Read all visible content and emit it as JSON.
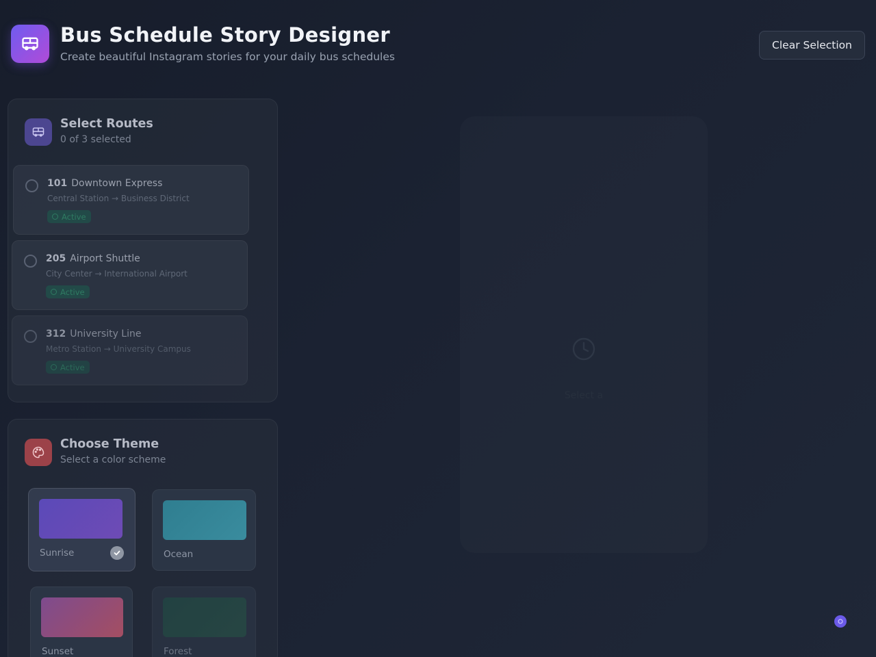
{
  "header": {
    "title": "Bus Schedule Story Designer",
    "subtitle": "Create beautiful Instagram stories for your daily bus schedules",
    "logo_icon": "bus-icon",
    "clear_button": "Clear Selection"
  },
  "routes_card": {
    "title": "Select Routes",
    "subtitle": "0 of 3 selected",
    "icon": "bus-icon",
    "routes": [
      {
        "number": "101",
        "name": "Downtown Express",
        "path": "Central Station → Business District",
        "status": "Active"
      },
      {
        "number": "205",
        "name": "Airport Shuttle",
        "path": "City Center → International Airport",
        "status": "Active"
      },
      {
        "number": "312",
        "name": "University Line",
        "path": "Metro Station → University Campus",
        "status": "Active"
      }
    ]
  },
  "theme_card": {
    "title": "Choose Theme",
    "subtitle": "Select a color scheme",
    "icon": "palette-icon",
    "selected": "Sunrise",
    "themes": [
      {
        "name": "Sunrise",
        "color_from": "#5b4ab8",
        "color_to": "#6e4bb5"
      },
      {
        "name": "Ocean",
        "color_from": "#2f7e90",
        "color_to": "#3a8c9e"
      },
      {
        "name": "Sunset",
        "color_from": "#7e4b8e",
        "color_to": "#a44e62"
      },
      {
        "name": "Forest",
        "color_from": "#234c47",
        "color_to": "#295248"
      }
    ]
  },
  "preview": {
    "icon": "clock-icon",
    "text": "Select a"
  },
  "colors": {
    "accent": "#6f5cf0",
    "background": "#1b2232",
    "status_active": "#2f7b62"
  }
}
